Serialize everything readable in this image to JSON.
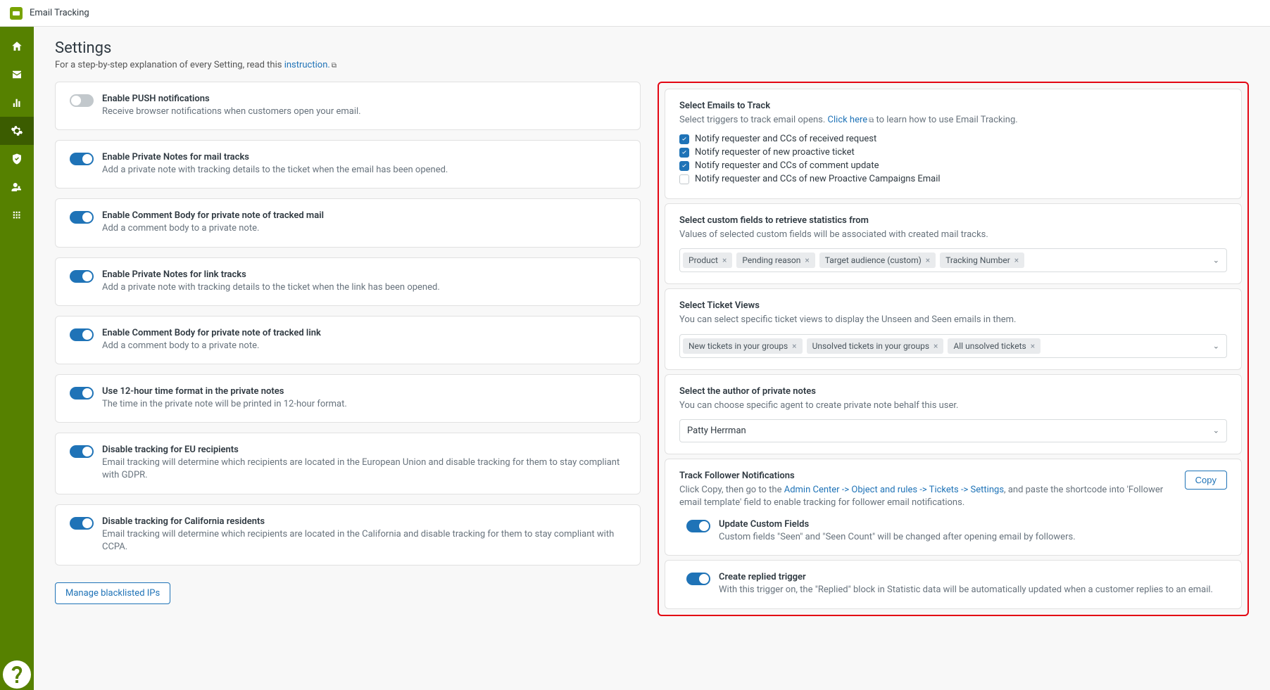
{
  "topbar": {
    "title": "Email Tracking"
  },
  "page": {
    "title": "Settings",
    "sub_pre": "For a step-by-step explanation of every Setting, read this ",
    "sub_link": "instruction.",
    "manage_btn": "Manage blacklisted IPs"
  },
  "toggles": {
    "push": {
      "title": "Enable PUSH notifications",
      "desc": "Receive browser notifications when customers open your email."
    },
    "pn_mail": {
      "title": "Enable Private Notes for mail tracks",
      "desc": "Add a private note with tracking details to the ticket when the email has been opened."
    },
    "cb_mail": {
      "title": "Enable Comment Body for private note of tracked mail",
      "desc": "Add a comment body to a private note."
    },
    "pn_link": {
      "title": "Enable Private Notes for link tracks",
      "desc": "Add a private note with tracking details to the ticket when the link has been opened."
    },
    "cb_link": {
      "title": "Enable Comment Body for private note of tracked link",
      "desc": "Add a comment body to a private note."
    },
    "hour12": {
      "title": "Use 12-hour time format in the private notes",
      "desc": "The time in the private note will be printed in 12-hour format."
    },
    "eu": {
      "title": "Disable tracking for EU recipients",
      "desc": "Email tracking will determine which recipients are located in the European Union and disable tracking for them to stay compliant with GDPR."
    },
    "ca": {
      "title": "Disable tracking for California residents",
      "desc": "Email tracking will determine which recipients are located in the California and disable tracking for them to stay compliant with CCPA."
    }
  },
  "emails": {
    "title": "Select Emails to Track",
    "desc_pre": "Select triggers to track email opens. ",
    "desc_link": "Click here",
    "desc_post": " to learn how to use Email Tracking.",
    "c1": "Notify requester and CCs of received request",
    "c2": "Notify requester of new proactive ticket",
    "c3": "Notify requester and CCs of comment update",
    "c4": "Notify requester and CCs of new Proactive Campaigns Email"
  },
  "cf": {
    "title": "Select custom fields to retrieve statistics from",
    "desc": "Values of selected custom fields will be associated with created mail tracks.",
    "t1": "Product",
    "t2": "Pending reason",
    "t3": "Target audience (custom)",
    "t4": "Tracking Number"
  },
  "views": {
    "title": "Select Ticket Views",
    "desc": "You can select specific ticket views to display the Unseen and Seen emails in them.",
    "t1": "New tickets in your groups",
    "t2": "Unsolved tickets in your groups",
    "t3": "All unsolved tickets"
  },
  "author": {
    "title": "Select the author of private notes",
    "desc": "You can choose specific agent to create private note behalf this user.",
    "value": "Patty Herrman"
  },
  "follower": {
    "title": "Track Follower Notifications",
    "pre": "Click Copy, then go to the ",
    "link": "Admin Center -> Object and rules -> Tickets -> Settings",
    "post": ", and paste the shortcode into 'Follower email template' field to enable tracking for follower email notifications.",
    "copy": "Copy",
    "ucf_title": "Update Custom Fields",
    "ucf_desc": "Custom fields \"Seen\" and \"Seen Count\" will be changed after opening email by followers."
  },
  "replied": {
    "title": "Create replied trigger",
    "desc": "With this trigger on, the \"Replied\" block in Statistic data will be automatically updated when a customer replies to an email."
  }
}
